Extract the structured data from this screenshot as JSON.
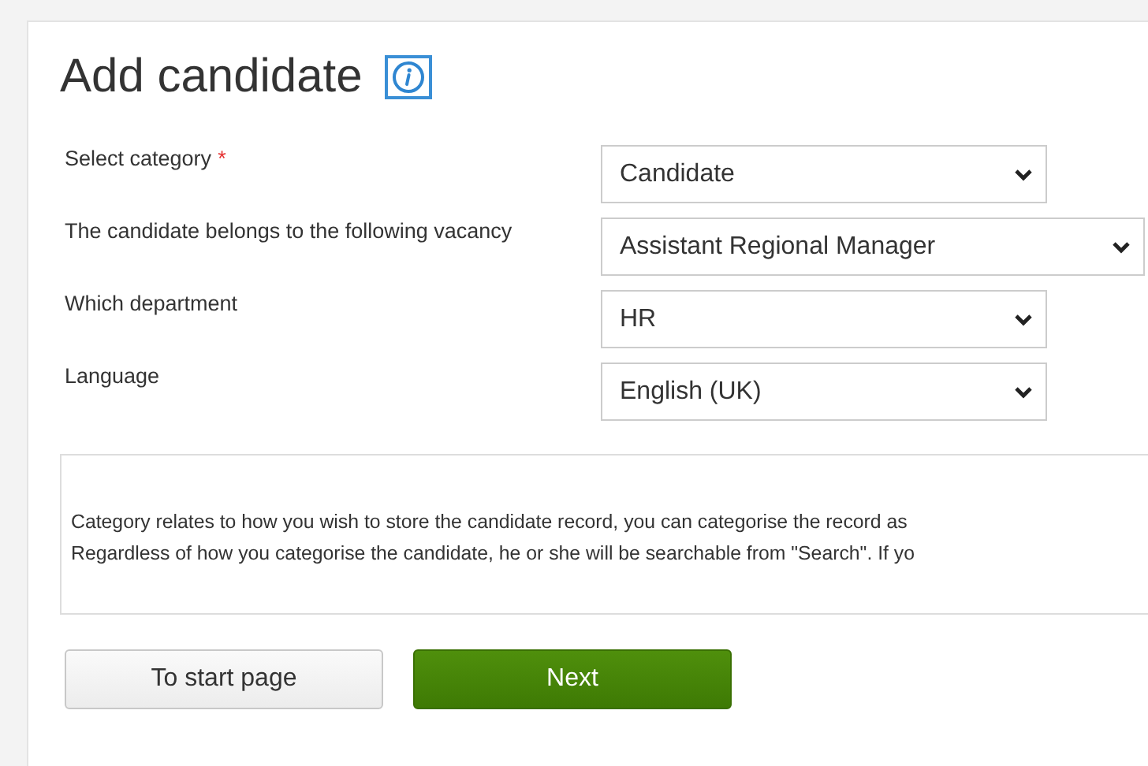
{
  "title": "Add candidate",
  "fields": [
    {
      "label": "Select category",
      "required_marker": "*",
      "value": "Candidate",
      "wide": false
    },
    {
      "label": "The candidate belongs to the following vacancy",
      "value": "Assistant Regional Manager",
      "wide": true
    },
    {
      "label": "Which department",
      "value": "HR",
      "wide": false
    },
    {
      "label": "Language",
      "value": "English (UK)",
      "wide": false
    }
  ],
  "info_lines": [
    "Category relates to how you wish to store the candidate record, you can categorise the record as",
    "Regardless of how you categorise the candidate, he or she will be searchable from \"Search\". If yo"
  ],
  "buttons": [
    {
      "label": "To start page",
      "kind": "secondary"
    },
    {
      "label": "Next",
      "kind": "primary"
    }
  ]
}
